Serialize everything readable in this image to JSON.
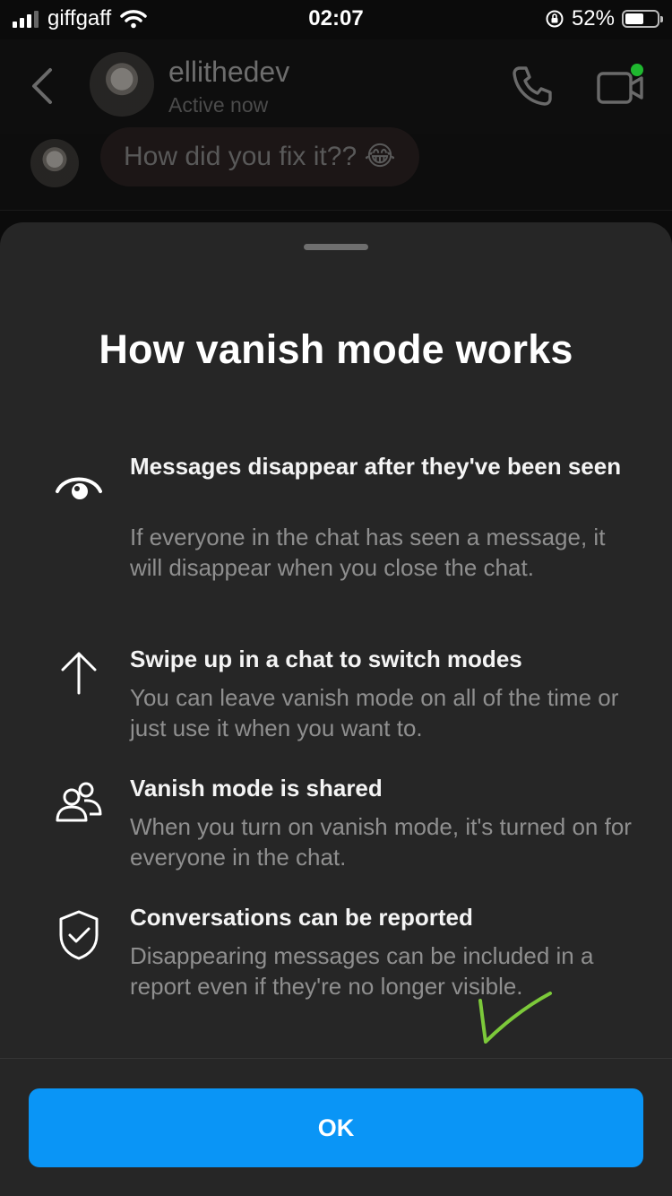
{
  "status_bar": {
    "carrier": "giffgaff",
    "time": "02:07",
    "battery_text": "52%",
    "battery_level": 0.52
  },
  "chat_header": {
    "username": "ellithedev",
    "status": "Active now",
    "icons": [
      "chevron-left-icon",
      "phone-icon",
      "video-call-icon"
    ],
    "active_dot_color": "#1fb82f"
  },
  "messages": [
    {
      "text": "How did you fix it?? 😂"
    }
  ],
  "sheet": {
    "title": "How vanish mode works",
    "features": [
      {
        "icon": "eye-icon",
        "title": "Messages disappear after they've been seen",
        "description": "If everyone in the chat has seen a message, it will disappear when you close the chat."
      },
      {
        "icon": "arrow-up-icon",
        "title": "Swipe up in a chat to switch modes",
        "description": "You can leave vanish mode on all of the time or just use it when you want to."
      },
      {
        "icon": "people-icon",
        "title": "Vanish mode is shared",
        "description": "When you turn on vanish mode, it's turned on for everyone in the chat."
      },
      {
        "icon": "shield-check-icon",
        "title": "Conversations can be reported",
        "description": "Disappearing messages can be included in a report even if they're no longer visible."
      }
    ],
    "ok_label": "OK"
  },
  "colors": {
    "accent": "#0a95f6",
    "sheet_background": "#262626",
    "annotation_check": "#7cc93a"
  }
}
